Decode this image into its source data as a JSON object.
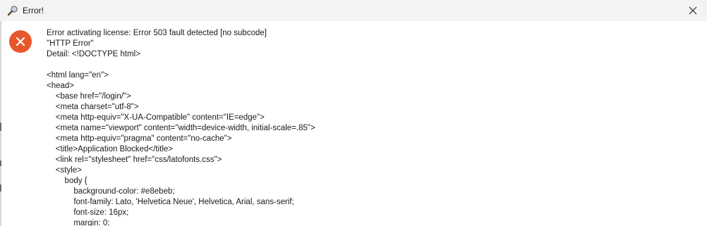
{
  "window": {
    "title": "Error!"
  },
  "message": {
    "lines": [
      "Error activating license: Error 503 fault detected [no subcode]",
      "\"HTTP Error\"",
      "Detail: <!DOCTYPE html>",
      "",
      "<html lang=\"en\">",
      "<head>",
      "    <base href=\"/login/\">",
      "    <meta charset=\"utf-8\">",
      "    <meta http-equiv=\"X-UA-Compatible\" content=\"IE=edge\">",
      "    <meta name=\"viewport\" content=\"width=device-width, initial-scale=.85\">",
      "    <meta http-equiv=\"pragma\" content=\"no-cache\">",
      "    <title>Application Blocked</title>",
      "    <link rel=\"stylesheet\" href=\"css/latofonts.css\">",
      "    <style>",
      "        body {",
      "            background-color: #e8ebeb;",
      "            font-family: Lato, 'Helvetica Neue', Helvetica, Arial, sans-serif;",
      "            font-size: 16px;",
      "            margin: 0;"
    ]
  },
  "icons": {
    "title": "magnifier-icon",
    "close": "close-icon",
    "error": "error-icon"
  },
  "colors": {
    "error_red": "#e8562b",
    "titlebar": "#f3f3f3",
    "text": "#1a1a1a"
  }
}
